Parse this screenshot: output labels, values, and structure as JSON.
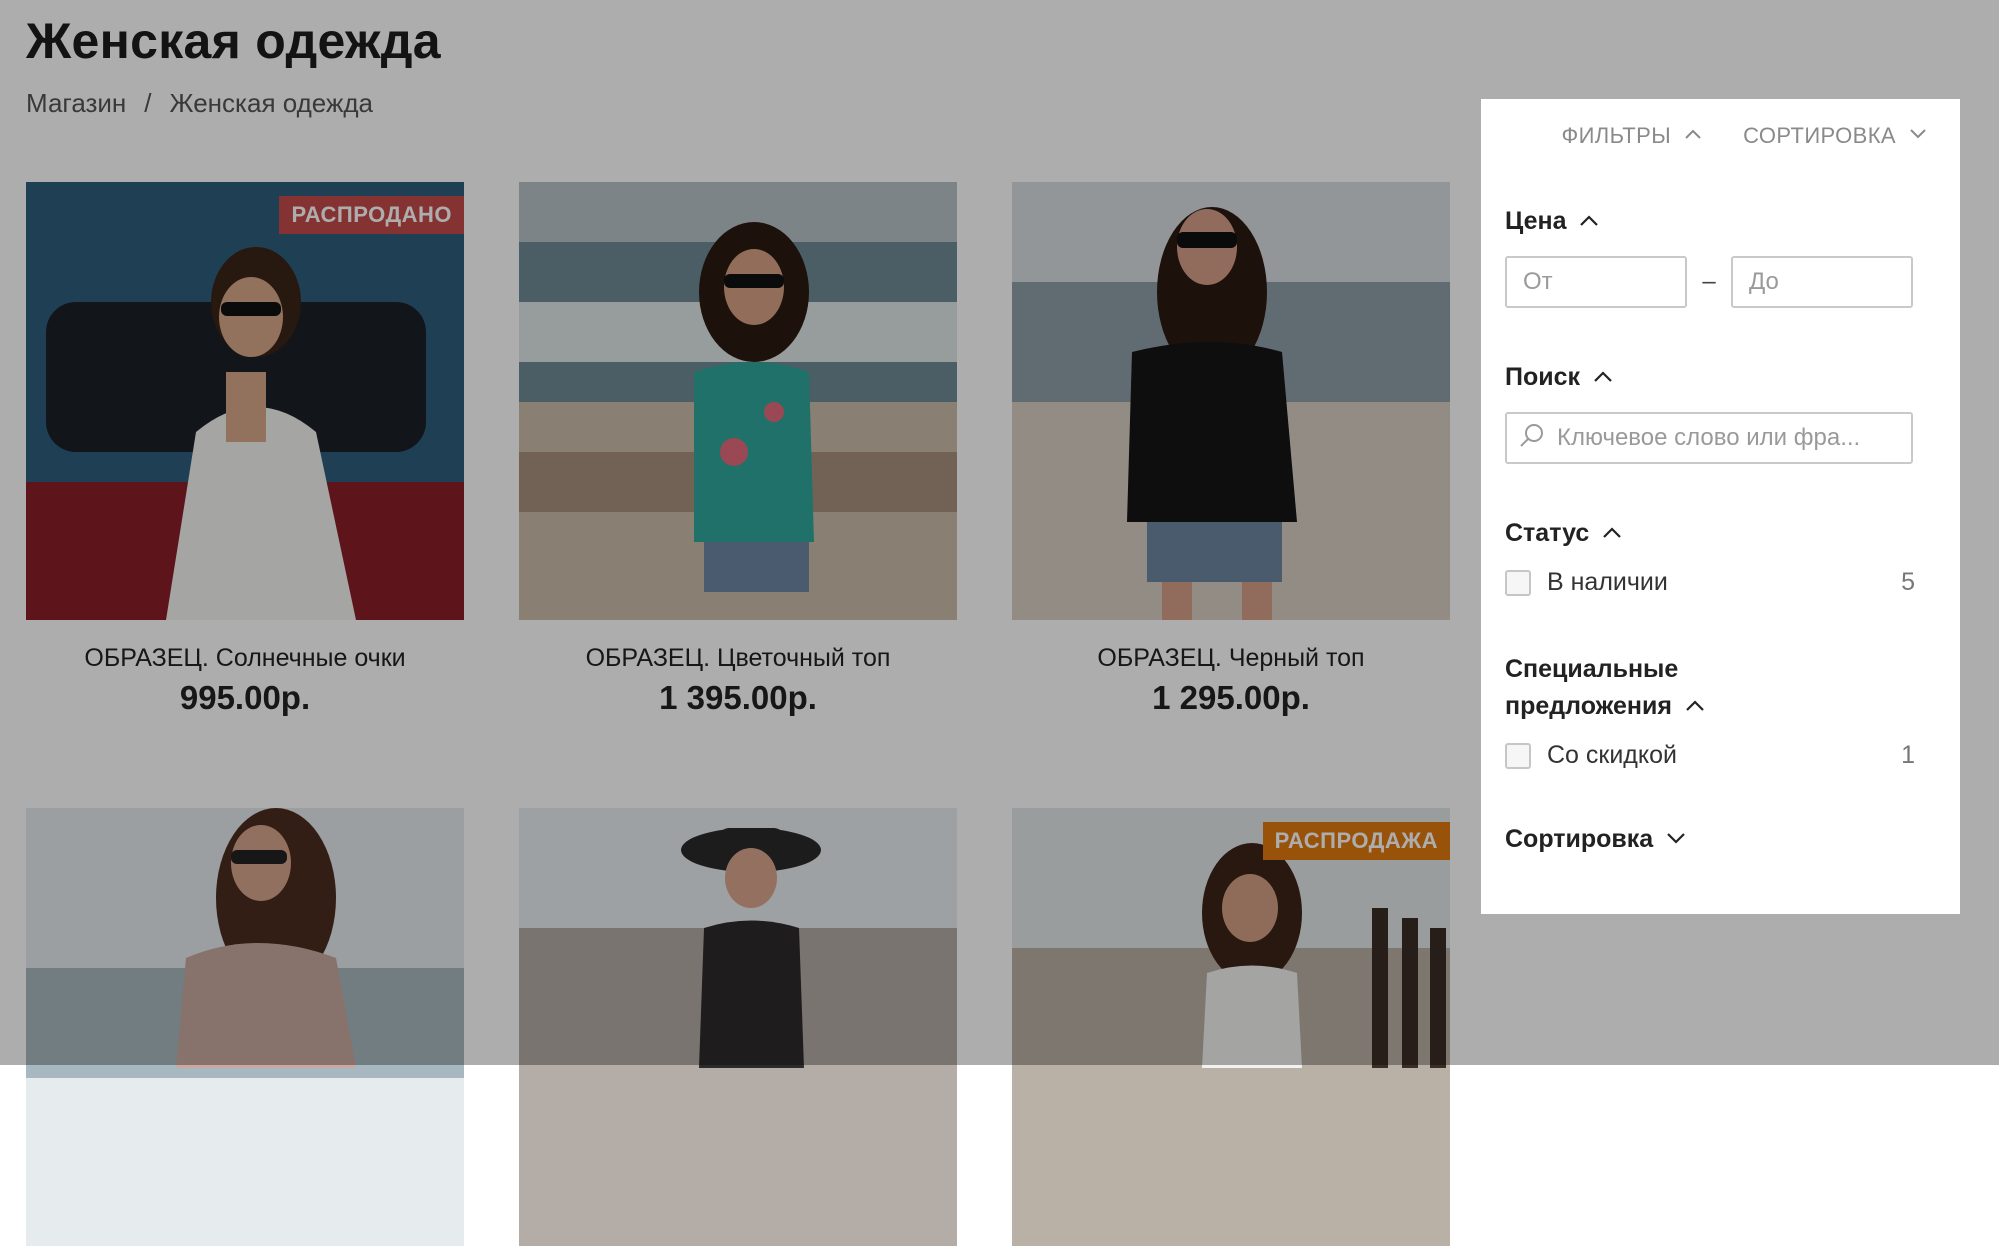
{
  "page": {
    "title": "Женская одежда",
    "breadcrumb": [
      "Магазин",
      "/",
      "Женская одежда"
    ]
  },
  "products": [
    {
      "name": "ОБРАЗЕЦ. Солнечные очки",
      "price": "995.00р.",
      "badge": "РАСПРОДАНО",
      "badge_color": "#c44a4a"
    },
    {
      "name": "ОБРАЗЕЦ. Цветочный топ",
      "price": "1 395.00р.",
      "badge": "",
      "badge_color": ""
    },
    {
      "name": "ОБРАЗЕЦ. Черный топ",
      "price": "1 295.00р.",
      "badge": "",
      "badge_color": ""
    },
    {
      "name": "",
      "price": "",
      "badge": "",
      "badge_color": ""
    },
    {
      "name": "",
      "price": "",
      "badge": "",
      "badge_color": ""
    },
    {
      "name": "",
      "price": "",
      "badge": "РАСПРОДАЖА",
      "badge_color": "#e07a10"
    }
  ],
  "filter_panel": {
    "tabs": {
      "filters": "ФИЛЬТРЫ",
      "sort": "СОРТИРОВКА"
    },
    "price": {
      "title": "Цена",
      "from_placeholder": "От",
      "to_placeholder": "До",
      "dash": "–"
    },
    "search": {
      "title": "Поиск",
      "placeholder": "Ключевое слово или фра..."
    },
    "status": {
      "title": "Статус",
      "option": "В наличии",
      "count": "5"
    },
    "offers": {
      "title_line1": "Специальные",
      "title_line2": "предложения",
      "option": "Со скидкой",
      "count": "1"
    },
    "sorting": {
      "title": "Сортировка"
    }
  },
  "colors": {
    "overlay": "rgba(0,0,0,0.32)",
    "sold_badge": "#c44a4a",
    "sale_badge": "#e07a10"
  }
}
